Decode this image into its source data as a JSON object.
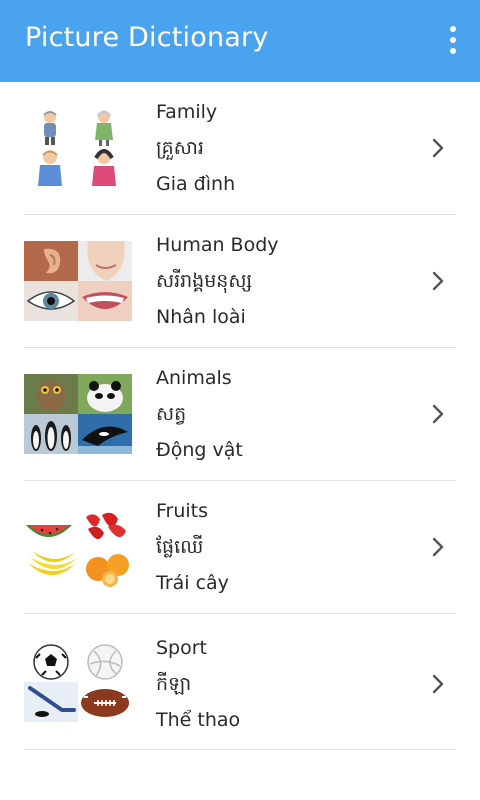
{
  "app": {
    "title": "Picture Dictionary"
  },
  "categories": [
    {
      "en": "Family",
      "km": "គ្រួសារ",
      "vi": "Gia đình",
      "icon": "family-thumbnail"
    },
    {
      "en": "Human Body",
      "km": "សរីរាង្គមនុស្ស",
      "vi": "Nhân loài",
      "icon": "human-body-thumbnail"
    },
    {
      "en": "Animals",
      "km": "សត្វ",
      "vi": "Động vật",
      "icon": "animals-thumbnail"
    },
    {
      "en": "Fruits",
      "km": "ផ្លែឈើ",
      "vi": "Trái cây",
      "icon": "fruits-thumbnail"
    },
    {
      "en": "Sport",
      "km": "កីឡា",
      "vi": "Thể thao",
      "icon": "sport-thumbnail"
    }
  ],
  "colors": {
    "appbar": "#4aa3ee",
    "divider": "#e0e0e0",
    "chevron": "#555555"
  }
}
